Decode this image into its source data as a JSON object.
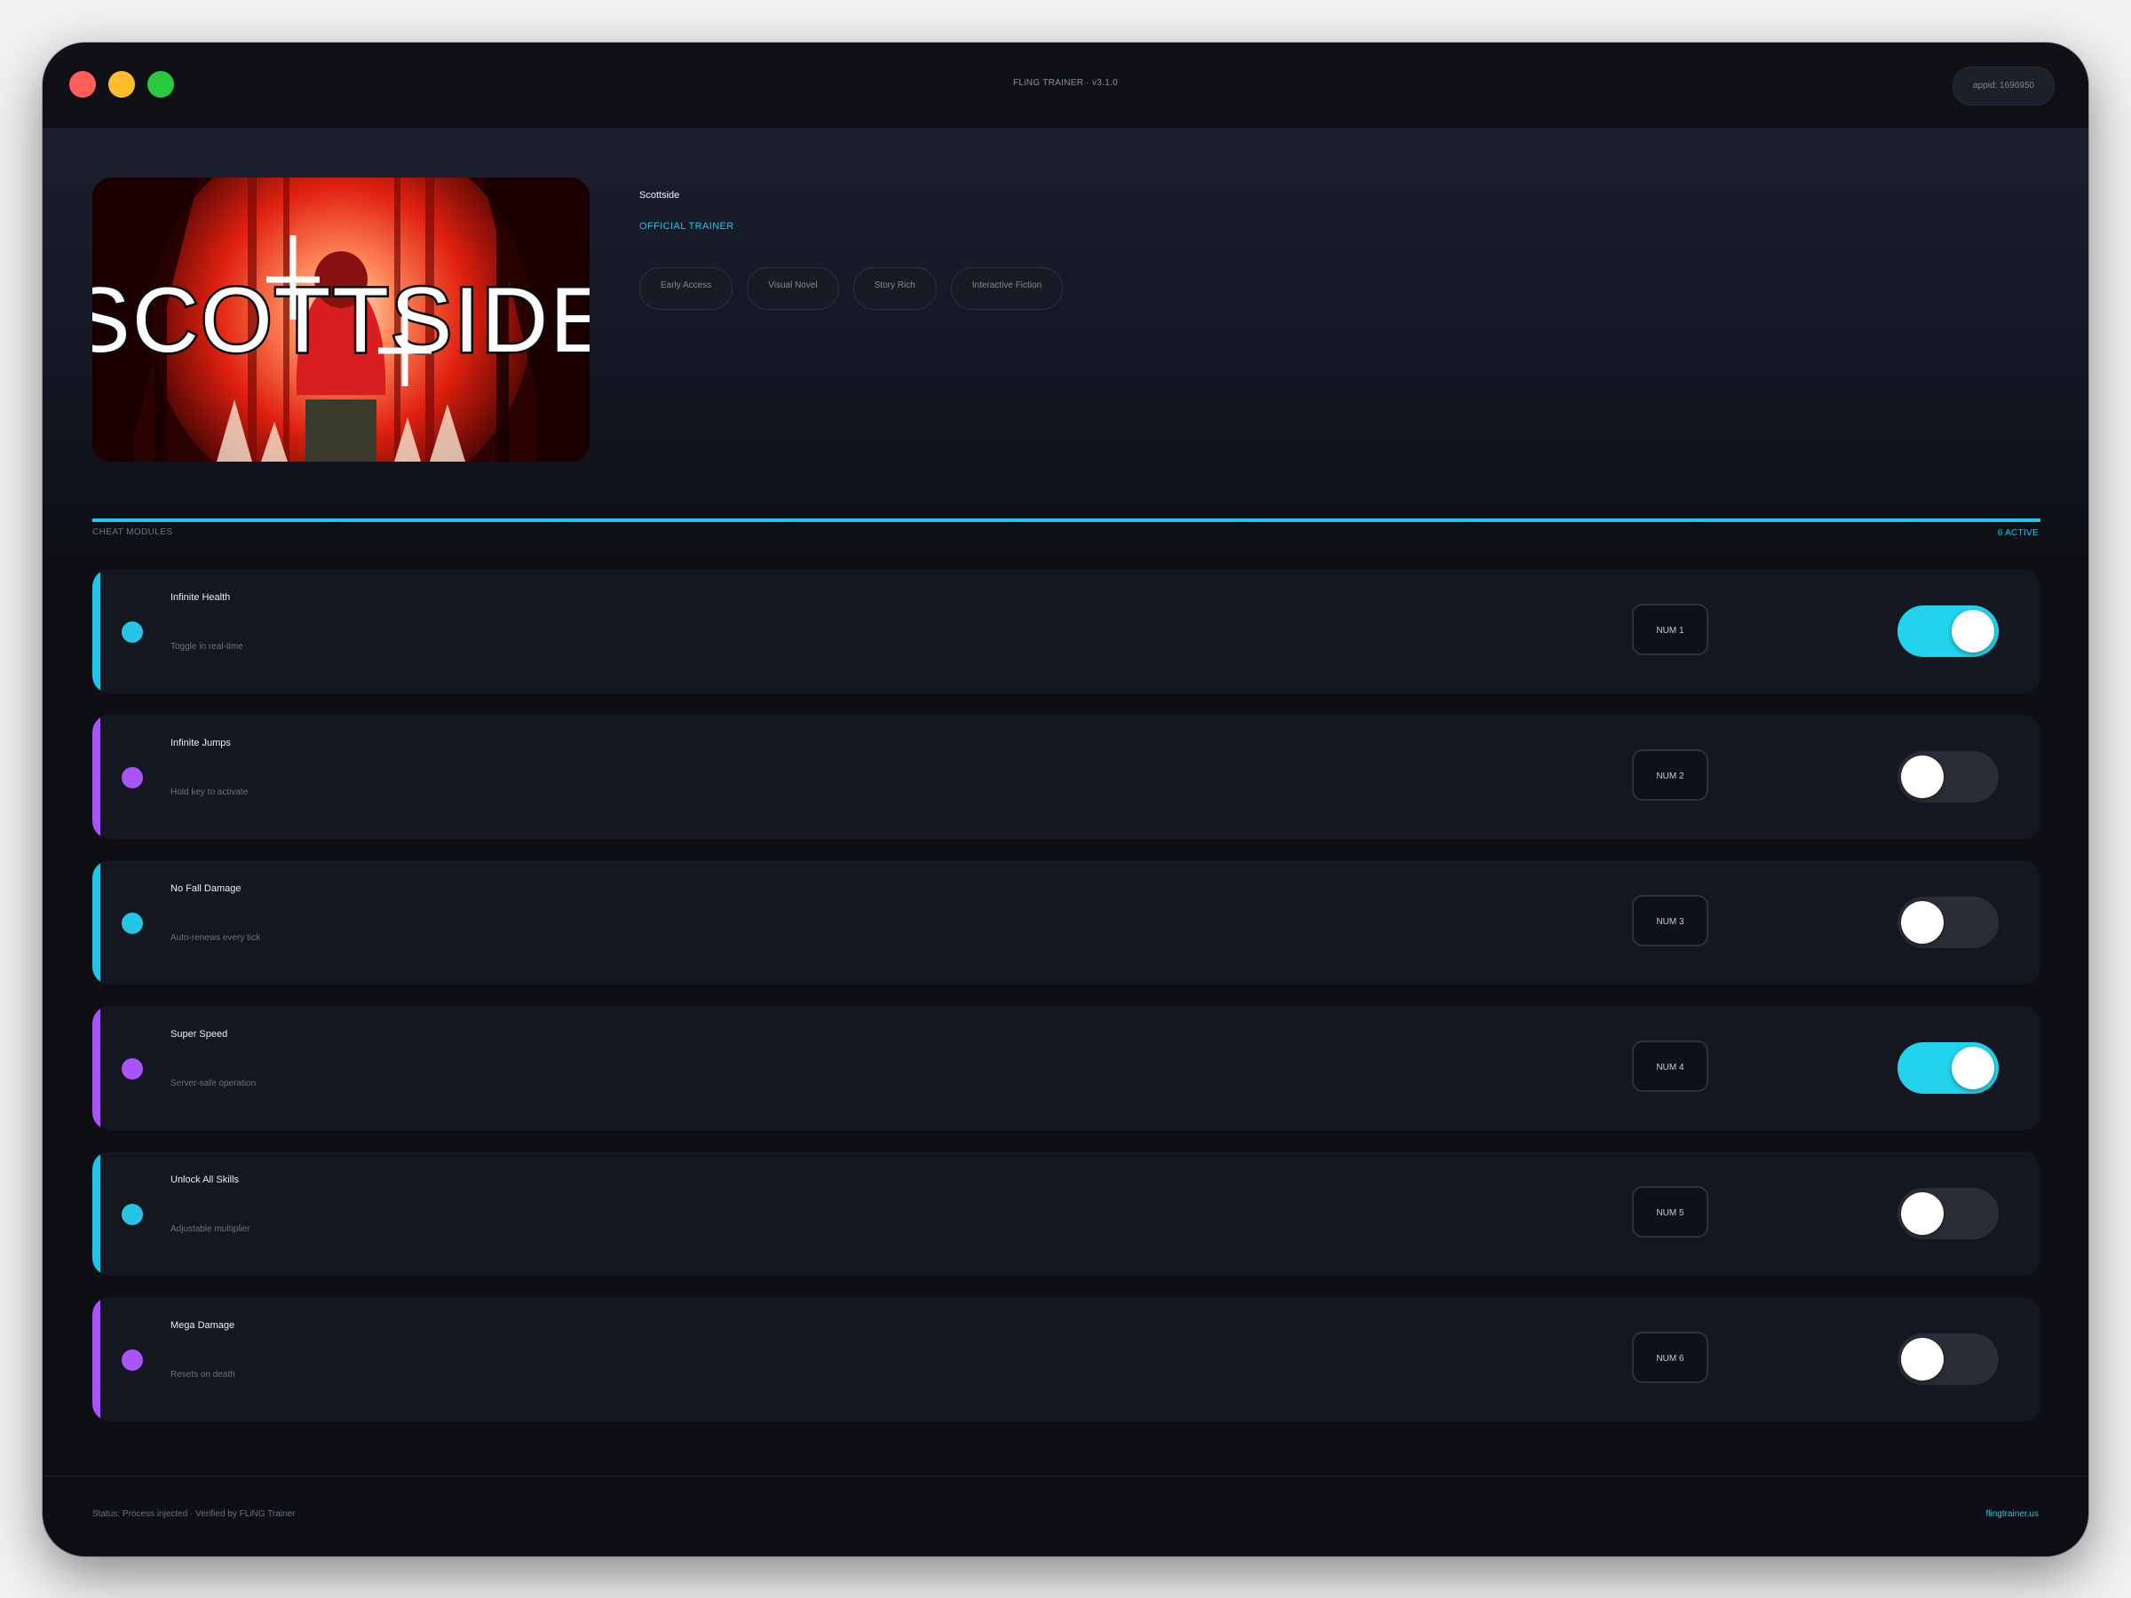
{
  "window": {
    "title": "FLiNG TRAINER · v3.1.0",
    "appid": "appid: 1696950"
  },
  "game": {
    "cover_text": "SCOTTSIDE",
    "title": "Scottside",
    "badge": "OFFICIAL TRAINER",
    "tags": [
      "Early Access",
      "Visual Novel",
      "Story Rich",
      "Interactive Fiction"
    ]
  },
  "modules": {
    "label": "CHEAT MODULES",
    "active_count": "6 ACTIVE",
    "items": [
      {
        "title": "Infinite Health",
        "subtitle": "Toggle in real-time",
        "hotkey": "NUM 1",
        "enabled": true,
        "accent": "#22c5e4"
      },
      {
        "title": "Infinite Jumps",
        "subtitle": "Hold key to activate",
        "hotkey": "NUM 2",
        "enabled": false,
        "accent": "#a855f7"
      },
      {
        "title": "No Fall Damage",
        "subtitle": "Auto-renews every tick",
        "hotkey": "NUM 3",
        "enabled": false,
        "accent": "#22c5e4"
      },
      {
        "title": "Super Speed",
        "subtitle": "Server-safe operation",
        "hotkey": "NUM 4",
        "enabled": true,
        "accent": "#a855f7"
      },
      {
        "title": "Unlock All Skills",
        "subtitle": "Adjustable multiplier",
        "hotkey": "NUM 5",
        "enabled": false,
        "accent": "#22c5e4"
      },
      {
        "title": "Mega Damage",
        "subtitle": "Resets on death",
        "hotkey": "NUM 6",
        "enabled": false,
        "accent": "#a855f7"
      }
    ]
  },
  "footer": {
    "status": "Status: Process injected · Verified by FLiNG Trainer",
    "link": "flingtrainer.us"
  },
  "colors": {
    "accent_cyan": "#22c5e4",
    "accent_purple": "#a855f7",
    "toggle_on": "#22d3ee",
    "toggle_off": "#2a2d37"
  }
}
